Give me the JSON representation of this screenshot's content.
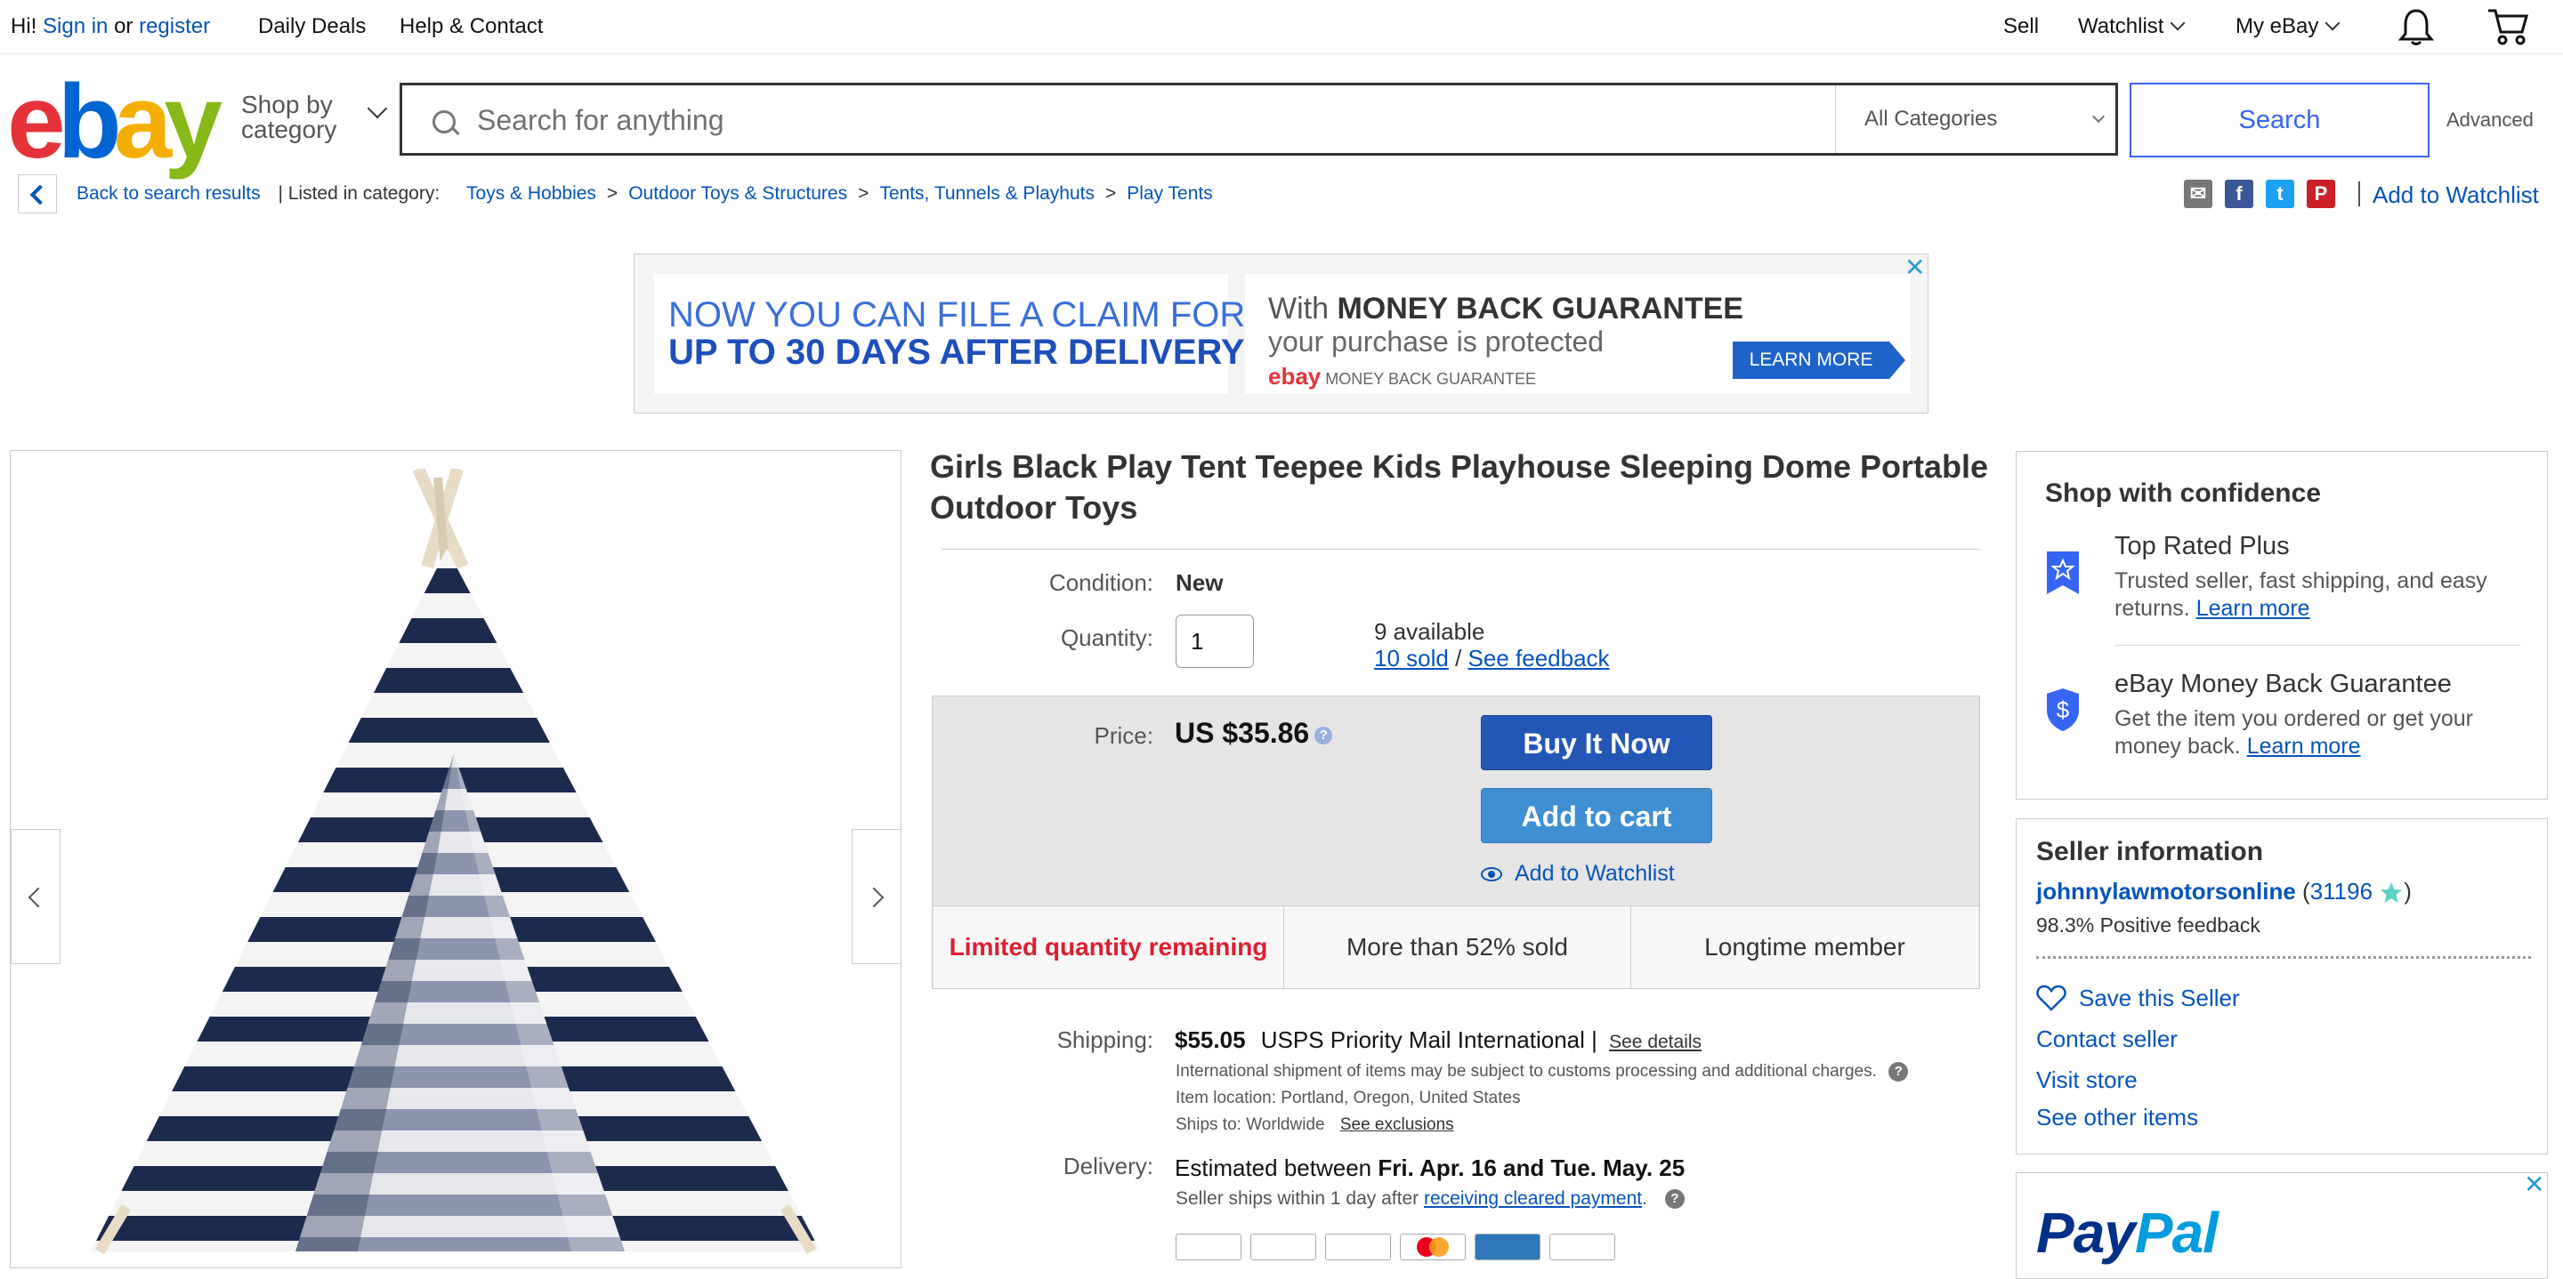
{
  "topbar": {
    "greeting": "Hi!",
    "sign_in": "Sign in",
    "or": "or",
    "register": "register",
    "daily_deals": "Daily Deals",
    "help_contact": "Help & Contact",
    "sell": "Sell",
    "watchlist": "Watchlist",
    "my_ebay": "My eBay"
  },
  "header": {
    "logo": {
      "e": "e",
      "b": "b",
      "a": "a",
      "y": "y"
    },
    "shop_by_line1": "Shop by",
    "shop_by_line2": "category",
    "search_placeholder": "Search for anything",
    "category": "All Categories",
    "search_button": "Search",
    "advanced": "Advanced"
  },
  "breadcrumb": {
    "back": "Back to search results",
    "listed_in": "| Listed in category:",
    "items": [
      "Toys & Hobbies",
      "Outdoor Toys & Structures",
      "Tents, Tunnels & Playhuts",
      "Play Tents"
    ],
    "separator": ">",
    "add_to_watchlist": "Add to Watchlist"
  },
  "share_icons": [
    {
      "name": "email-share-icon",
      "color": "#777777",
      "glyph": "✉"
    },
    {
      "name": "facebook-share-icon",
      "color": "#3b5998",
      "glyph": "f"
    },
    {
      "name": "twitter-share-icon",
      "color": "#1da1f2",
      "glyph": "t"
    },
    {
      "name": "pinterest-share-icon",
      "color": "#cb2027",
      "glyph": "P"
    }
  ],
  "ad": {
    "left_line1": "NOW YOU CAN FILE A CLAIM FOR",
    "left_line2": "UP TO 30 DAYS AFTER  DELIVERY",
    "right_line1_prefix": "With ",
    "right_line1_bold": "MONEY BACK GUARANTEE",
    "right_line2": "your purchase is protected",
    "right_logo": "ebay",
    "right_line3": "MONEY BACK GUARANTEE",
    "learn_more": "LEARN MORE",
    "close": "✕"
  },
  "item": {
    "title": "Girls Black Play Tent Teepee Kids Playhouse Sleeping Dome Portable Outdoor Toys",
    "condition_label": "Condition:",
    "condition": "New",
    "quantity_label": "Quantity:",
    "quantity": "1",
    "available": "9 available",
    "sold": "10 sold",
    "slash": "/",
    "see_feedback": "See feedback",
    "price_label": "Price:",
    "price": "US $35.86",
    "buy_it_now": "Buy It Now",
    "add_to_cart": "Add to cart",
    "add_to_watchlist": "Add to Watchlist",
    "stats": [
      "Limited quantity remaining",
      "More than 52% sold",
      "Longtime member"
    ],
    "shipping_label": "Shipping:",
    "shipping_cost": "$55.05",
    "shipping_service": "USPS Priority Mail International |",
    "see_details": "See details",
    "intl_note": "International shipment of items may be subject to customs processing and additional charges.",
    "item_location": "Item location:  Portland, Oregon, United States",
    "ships_to": "Ships to:  Worldwide",
    "see_exclusions": "See exclusions",
    "delivery_label": "Delivery:",
    "delivery_prefix": "Estimated between ",
    "delivery_dates": "Fri. Apr. 16 and Tue. May. 25",
    "handling_prefix": "Seller ships within 1 day after ",
    "handling_link": "receiving cleared payment",
    "handling_suffix": "."
  },
  "confidence": {
    "title": "Shop with confidence",
    "top_rated_title": "Top Rated Plus",
    "top_rated_desc": "Trusted seller, fast shipping, and easy returns.",
    "mbg_title": "eBay Money Back Guarantee",
    "mbg_desc": "Get the item you ordered or get your money back.",
    "learn_more": "Learn more"
  },
  "seller": {
    "title": "Seller information",
    "name": "johnnylawmotorsonline",
    "score": "31196",
    "feedback": "98.3% Positive feedback",
    "save": "Save this Seller",
    "contact": "Contact seller",
    "visit": "Visit store",
    "other": "See other items"
  },
  "paypal": {
    "pay": "Pay",
    "pal": "Pal"
  },
  "colors": {
    "link": "#0654ba",
    "search_button": "#3665f3",
    "buy_now": "#2457b5",
    "add_to_cart": "#3f8fd2",
    "limited_red": "#dd1e31"
  }
}
